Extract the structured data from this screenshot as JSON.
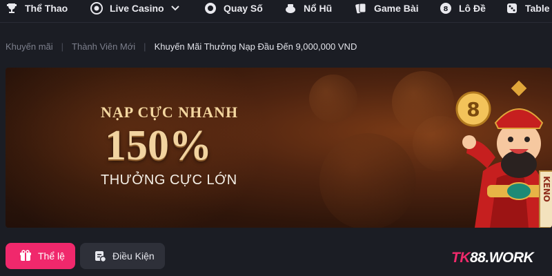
{
  "nav": {
    "items": [
      {
        "label": "Thể Thao",
        "icon": "trophy-icon"
      },
      {
        "label": "Live Casino",
        "icon": "casino-chip-icon"
      },
      {
        "label": "Quay Số",
        "icon": "lottery-ball-icon"
      },
      {
        "label": "Nổ Hũ",
        "icon": "jackpot-pot-icon"
      },
      {
        "label": "Game Bài",
        "icon": "cards-icon"
      },
      {
        "label": "Lô Đề",
        "icon": "lotto-icon"
      },
      {
        "label": "Table",
        "icon": "dice-icon"
      }
    ]
  },
  "breadcrumb": {
    "items": [
      "Khuyến mãi",
      "Thành Viên Mới",
      "Khuyến Mãi Thưởng Nạp Đầu Đến 9,000,000 VND"
    ],
    "separator": "|"
  },
  "banner": {
    "line1": "NẠP CỰC NHANH",
    "percent": "150%",
    "line3": "THƯỞNG CỰC LỚN",
    "mascot_sign": "KENO",
    "coin_number": "8"
  },
  "buttons": {
    "rules_label": "Thể lệ",
    "conditions_label": "Điều Kiện"
  },
  "watermark": {
    "prefix": "TK",
    "suffix": "88.WORK"
  },
  "colors": {
    "background": "#1b1d24",
    "accent_pink": "#f0286c",
    "secondary_button": "#2e3039",
    "banner_gold": "#f1d3a0"
  }
}
